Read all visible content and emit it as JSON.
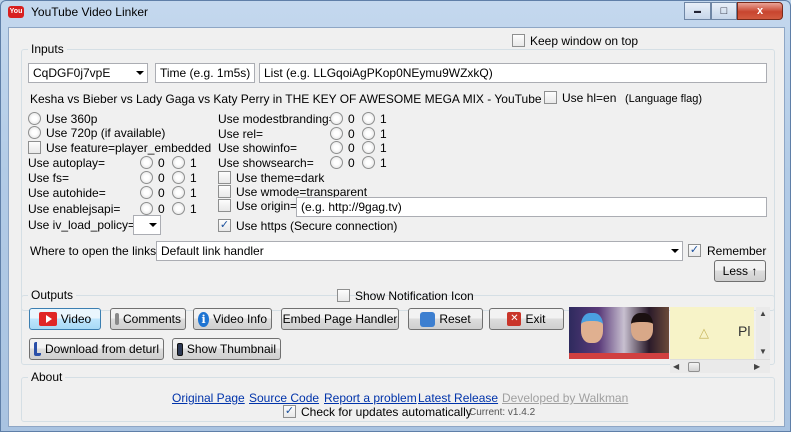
{
  "window": {
    "title": "YouTube Video Linker",
    "minimize_glyph": "▬",
    "maximize_glyph": "□",
    "close_glyph": "x",
    "app_icon_text": "You"
  },
  "inputs": {
    "group_title": "Inputs",
    "keep_on_top": {
      "label": "Keep window on top",
      "checked": false
    },
    "video_id_value": "CqDGF0j7vpE",
    "time_placeholder": "Time (e.g. 1m5s)",
    "list_placeholder": "List (e.g. LLGqoiAgPKop0NEymu9WZxkQ)",
    "video_title": "Kesha vs Bieber vs Lady Gaga vs Katy Perry in THE KEY OF AWESOME MEGA MIX - YouTube",
    "use_hl_en": {
      "label": "Use hl=en",
      "checked": false
    },
    "language_flag": "(Language flag)",
    "radios_left": [
      {
        "label": "Use 360p",
        "selected": false
      },
      {
        "label": "Use 720p (if available)",
        "selected": false
      }
    ],
    "use_feature": {
      "label": "Use feature=player_embedded",
      "checked": false
    },
    "params_left": [
      {
        "label": "Use autoplay=",
        "zero": "0",
        "one": "1"
      },
      {
        "label": "Use fs=",
        "zero": "0",
        "one": "1"
      },
      {
        "label": "Use autohide=",
        "zero": "0",
        "one": "1"
      },
      {
        "label": "Use enablejsapi=",
        "zero": "0",
        "one": "1"
      }
    ],
    "iv_load_policy_label": "Use iv_load_policy=",
    "params_right": [
      {
        "label": "Use modestbranding=",
        "zero": "0",
        "one": "1"
      },
      {
        "label": "Use rel=",
        "zero": "0",
        "one": "1"
      },
      {
        "label": "Use showinfo=",
        "zero": "0",
        "one": "1"
      },
      {
        "label": "Use showsearch=",
        "zero": "0",
        "one": "1"
      }
    ],
    "use_theme": {
      "label": "Use theme=dark",
      "checked": false
    },
    "use_wmode": {
      "label": "Use wmode=transparent",
      "checked": false
    },
    "use_origin": {
      "label": "Use origin=",
      "checked": false
    },
    "origin_placeholder": "(e.g. http://9gag.tv)",
    "use_https": {
      "label": "Use https (Secure connection)",
      "checked": true
    },
    "open_links_label": "Where to open the links:",
    "link_handler_value": "Default link handler",
    "remember": {
      "label": "Remember",
      "checked": true
    },
    "less_button": "Less ↑"
  },
  "outputs": {
    "group_title": "Outputs",
    "show_notification": {
      "label": "Show Notification Icon",
      "checked": false
    },
    "buttons_row1": [
      "Video",
      "Comments",
      "Video Info",
      "Embed Page Handler",
      "Reset",
      "Exit"
    ],
    "buttons_row2": [
      "Download from deturl",
      "Show Thumbnail"
    ],
    "ad_text": "Pl"
  },
  "about": {
    "group_title": "About",
    "links": [
      "Original Page",
      "Source Code",
      "Report a problem",
      "Latest Release"
    ],
    "developer_credit": "Developed by Walkman",
    "check_updates": {
      "label": "Check for updates automatically",
      "checked": true
    },
    "current_version": "Current: v1.4.2"
  },
  "colors": {
    "accent": "#3c7fb1",
    "link": "#0033aa",
    "youtube_red": "#e02626"
  }
}
